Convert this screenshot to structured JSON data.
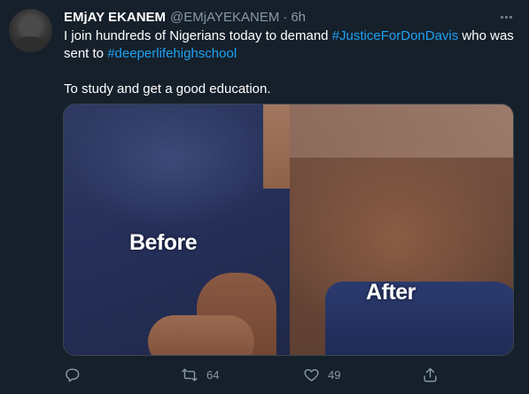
{
  "tweet": {
    "author_name": "EMjAY EKANEM",
    "author_handle": "@EMjAYEKANEM",
    "separator": "·",
    "time": "6h",
    "text": {
      "line1_prefix": "I join hundreds of Nigerians today to demand ",
      "hashtag1": "#JusticeForDonDavis",
      "line1_suffix": " who was sent to ",
      "hashtag2": "#deeperlifehighschool",
      "paragraph2": "To study and get a good education."
    },
    "media": {
      "label_before": "Before",
      "label_after": "After"
    },
    "actions": {
      "reply_icon": "reply-icon",
      "retweet_icon": "retweet-icon",
      "retweet_count": "64",
      "like_icon": "heart-icon",
      "like_count": "49",
      "share_icon": "share-icon"
    }
  },
  "colors": {
    "background": "#15202b",
    "secondary_text": "#8899a6",
    "link": "#1da1f2",
    "border": "#38444d"
  }
}
